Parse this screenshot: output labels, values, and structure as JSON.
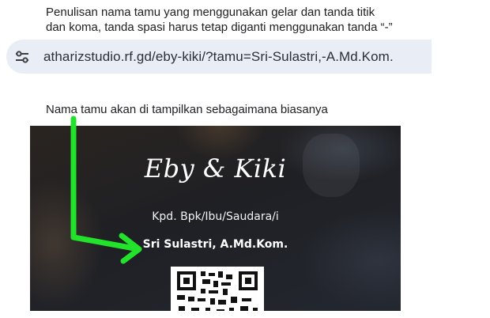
{
  "instructions": {
    "top_note_line1": "Penulisan nama tamu yang menggunakan gelar dan tanda titik",
    "top_note_line2": "dan koma, tanda spasi harus tetap diganti menggunakan tanda “-”",
    "middle_note": "Nama tamu akan di tampilkan sebagaimana biasanya"
  },
  "address_bar": {
    "url": "atharizstudio.rf.gd/eby-kiki/?tamu=Sri-Sulastri,-A.Md.Kom.",
    "icon": "tune-icon"
  },
  "invitation_card": {
    "couple_names": "Eby & Kiki",
    "greeting": "Kpd. Bpk/Ibu/Saudara/i",
    "guest_name": "Sri Sulastri, A.Md.Kom."
  },
  "colors": {
    "arrow": "#22e22b",
    "address_bar_bg": "#e9edf6"
  }
}
